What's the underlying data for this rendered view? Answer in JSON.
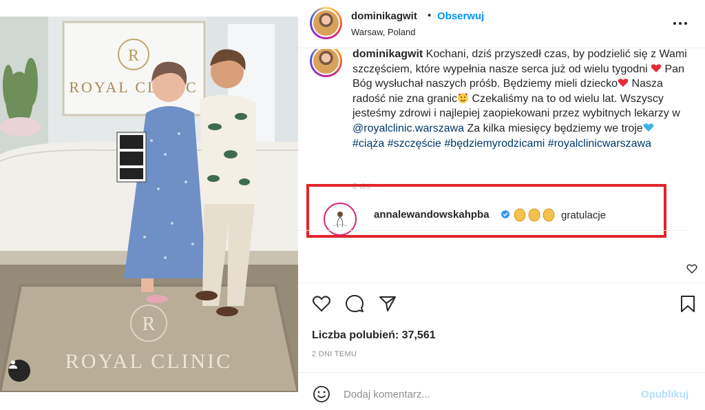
{
  "post": {
    "author": "dominikagwit",
    "dot": "•",
    "follow_label": "Obserwuj",
    "location": "Warsaw, Poland",
    "more_icon": "more-horizontal-icon"
  },
  "photo": {
    "wall_sign_letter": "R",
    "wall_sign_text": "ROYAL CLINIC",
    "mat_letter": "R",
    "mat_text": "ROYAL CLINIC"
  },
  "caption": {
    "username": "dominikagwit",
    "line1": " Kochani, dziś przyszedł czas, by podzielić się z Wami szczęściem, które wypełnia nasze serca już od wielu tygodni ",
    "line2": " Pan Bóg wysłuchał naszych próśb. Będziemy mieli dziecko",
    "line3": " Nasza radość nie zna granic",
    "line4": " Czekaliśmy na to od wielu lat. Wszyscy jesteśmy zdrowi i najlepiej zaopiekowani przez wybitnych lekarzy w ",
    "mention": "@royalclinic.warszawa",
    "line5": " Za kilka miesięcy będziemy we troje",
    "hashtags": [
      "#ciąża",
      "#szczęście",
      "#będziemyrodzicami",
      "#royalclinicwarszawa"
    ],
    "time": "2 dni"
  },
  "comment": {
    "username": "annalewandowskahpba",
    "verified": true,
    "emojis": "👏👏👏",
    "text": "gratulacje",
    "highlight_color": "#e2242b"
  },
  "actions": {
    "likes_label": "Liczba polubień: ",
    "likes_count": "37,561",
    "date": "2 DNI TEMU"
  },
  "add_comment": {
    "placeholder": "Dodaj komentarz...",
    "publish_label": "Opublikuj"
  },
  "colors": {
    "accent": "#0095f6",
    "link": "#00376b",
    "publish_disabled": "#b2dffc"
  }
}
